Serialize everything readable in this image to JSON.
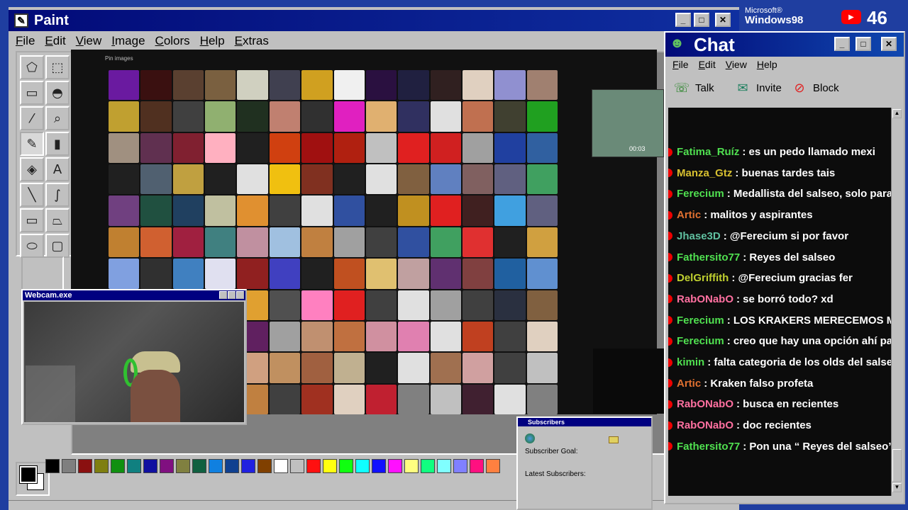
{
  "paint": {
    "title": "Paint",
    "menu": [
      "File",
      "Edit",
      "View",
      "Image",
      "Colors",
      "Help",
      "Extras"
    ],
    "canvas_label": "Pin images",
    "palette": [
      "#000000",
      "#7f7f7f",
      "#8a1010",
      "#7f7f10",
      "#109010",
      "#108080",
      "#1010a0",
      "#801080",
      "#808040",
      "#106040",
      "#1080e0",
      "#104090",
      "#2020e0",
      "#804000",
      "#ffffff",
      "#c0c0c0",
      "#ff1010",
      "#ffff10",
      "#10ff10",
      "#10ffff",
      "#1010ff",
      "#ff10ff",
      "#ffff80",
      "#10ff80",
      "#80ffff",
      "#8080ff",
      "#ff1080",
      "#ff8040"
    ],
    "thumb_colors": [
      "#6a1aa0",
      "#3a1010",
      "#5a4030",
      "#7a6040",
      "#d0d0c0",
      "#404050",
      "#d0a020",
      "#f0f0f0",
      "#2a1040",
      "#202040",
      "#302020",
      "#e0d0c0",
      "#9090d0",
      "#a08070",
      "#c0a030",
      "#503020",
      "#404040",
      "#90b070",
      "#203020",
      "#c08070",
      "#303030",
      "#e020c0",
      "#e0b070",
      "#303060",
      "#e0e0e0",
      "#c07050",
      "#404030",
      "#20a020",
      "#a09080",
      "#603050",
      "#802030",
      "#ffb0c0",
      "#202020",
      "#d04010",
      "#a01010",
      "#b02010",
      "#c0c0c0",
      "#e02020",
      "#d02020",
      "#a0a0a0",
      "#2040a0",
      "#3060a0",
      "#202020",
      "#506070",
      "#c0a040",
      "#202020",
      "#e0e0e0",
      "#f0c010",
      "#803020",
      "#202020",
      "#e0e0e0",
      "#806040",
      "#6080c0",
      "#806060",
      "#606080",
      "#40a060",
      "#704080",
      "#205040",
      "#204060",
      "#c0c0a0",
      "#e09030",
      "#404040",
      "#e0e0e0",
      "#3050a0",
      "#202020",
      "#c09020",
      "#e02020",
      "#402020",
      "#40a0e0",
      "#606080",
      "#c08030",
      "#d06030",
      "#a02040",
      "#408080",
      "#c090a0",
      "#a0c0e0",
      "#c08040",
      "#a0a0a0",
      "#404040",
      "#3050a0",
      "#40a060",
      "#e03030",
      "#202020",
      "#d0a040",
      "#80a0e0",
      "#303030",
      "#4080c0",
      "#e0e0f0",
      "#902020",
      "#4040c0",
      "#202020",
      "#c05020",
      "#e0c070",
      "#c0a0a0",
      "#603070",
      "#804040",
      "#2060a0",
      "#6090d0",
      "#a07060",
      "#c0a0b0",
      "#808080",
      "#a0a0a0",
      "#e0a030",
      "#505050",
      "#ff80c0",
      "#e02020",
      "#404040",
      "#e0e0e0",
      "#a0a0a0",
      "#404040",
      "#2a3040",
      "#806040",
      "#808080",
      "#e0e0e0",
      "#c05030",
      "#e0e0e0",
      "#602060",
      "#a0a0a0",
      "#c09070",
      "#c07040",
      "#d090a0",
      "#e080b0",
      "#e0e0e0",
      "#c04020",
      "#404040",
      "#e0d0c0",
      "#c0c0c0",
      "#505050",
      "#e0e0e0",
      "#805030",
      "#d0a080",
      "#c09060",
      "#a06040",
      "#c0b090",
      "#202020",
      "#e0e0e0",
      "#a07050",
      "#d0a0a0",
      "#404040",
      "#c0c0c0",
      "#e0c0c0",
      "#303030",
      "#e0e0e0",
      "#602020",
      "#c08040",
      "#404040",
      "#a03020",
      "#e0d0c0",
      "#c02030",
      "#808080",
      "#c0c0c0",
      "#402030",
      "#e0e0e0",
      "#808080"
    ]
  },
  "webcam": {
    "title": "Webcam.exe"
  },
  "video": {
    "timestamp": "00:03"
  },
  "subscribers": {
    "title": "Subscribers",
    "goal_label": "Subscriber Goal:",
    "latest_label": "Latest Subscribers:"
  },
  "branding": {
    "microsoft": "Microsoft®",
    "windows": "Windows98"
  },
  "viewers": {
    "count": "46"
  },
  "chat": {
    "title": "Chat",
    "menu": [
      "File",
      "Edit",
      "View",
      "Help"
    ],
    "toolbar": {
      "talk": "Talk",
      "invite": "Invite",
      "block": "Block"
    },
    "messages": [
      {
        "name": "Fatima_Ruíz",
        "text": ": es un pedo llamado mexi",
        "color": "#50e050"
      },
      {
        "name": "Manza_Gtz",
        "text": ": buenas tardes tais",
        "color": "#d8c030"
      },
      {
        "name": "Ferecium",
        "text": ": Medallista del salseo, solo para Ra",
        "color": "#50e050"
      },
      {
        "name": "Artic",
        "text": ": malitos y aspirantes",
        "color": "#e07030"
      },
      {
        "name": "Jhase3D",
        "text": ": @Ferecium si por favor",
        "color": "#60c0a0"
      },
      {
        "name": "Fathersito77",
        "text": ": Reyes del salseo",
        "color": "#50e050"
      },
      {
        "name": "DelGriffith",
        "text": ": @Ferecium gracias fer",
        "color": "#c0d030"
      },
      {
        "name": "RabONabO",
        "text": ": se borró todo? xd",
        "color": "#ff70a0"
      },
      {
        "name": "Ferecium",
        "text": ": LOS KRAKERS MERECEMOS MAS V",
        "color": "#50e050"
      },
      {
        "name": "Ferecium",
        "text": ": creo que hay una opción ahí para su",
        "color": "#50e050"
      },
      {
        "name": "kimin",
        "text": ": falta categoria de los olds del salseo",
        "color": "#50e050"
      },
      {
        "name": "Artic",
        "text": ": Kraken falso profeta",
        "color": "#e07030"
      },
      {
        "name": "RabONabO",
        "text": ": busca en recientes",
        "color": "#ff70a0"
      },
      {
        "name": "RabONabO",
        "text": ": doc recientes",
        "color": "#ff70a0"
      },
      {
        "name": "Fathersito77",
        "text": ": Pon una “ Reyes del salseo”",
        "color": "#50e050"
      }
    ]
  }
}
